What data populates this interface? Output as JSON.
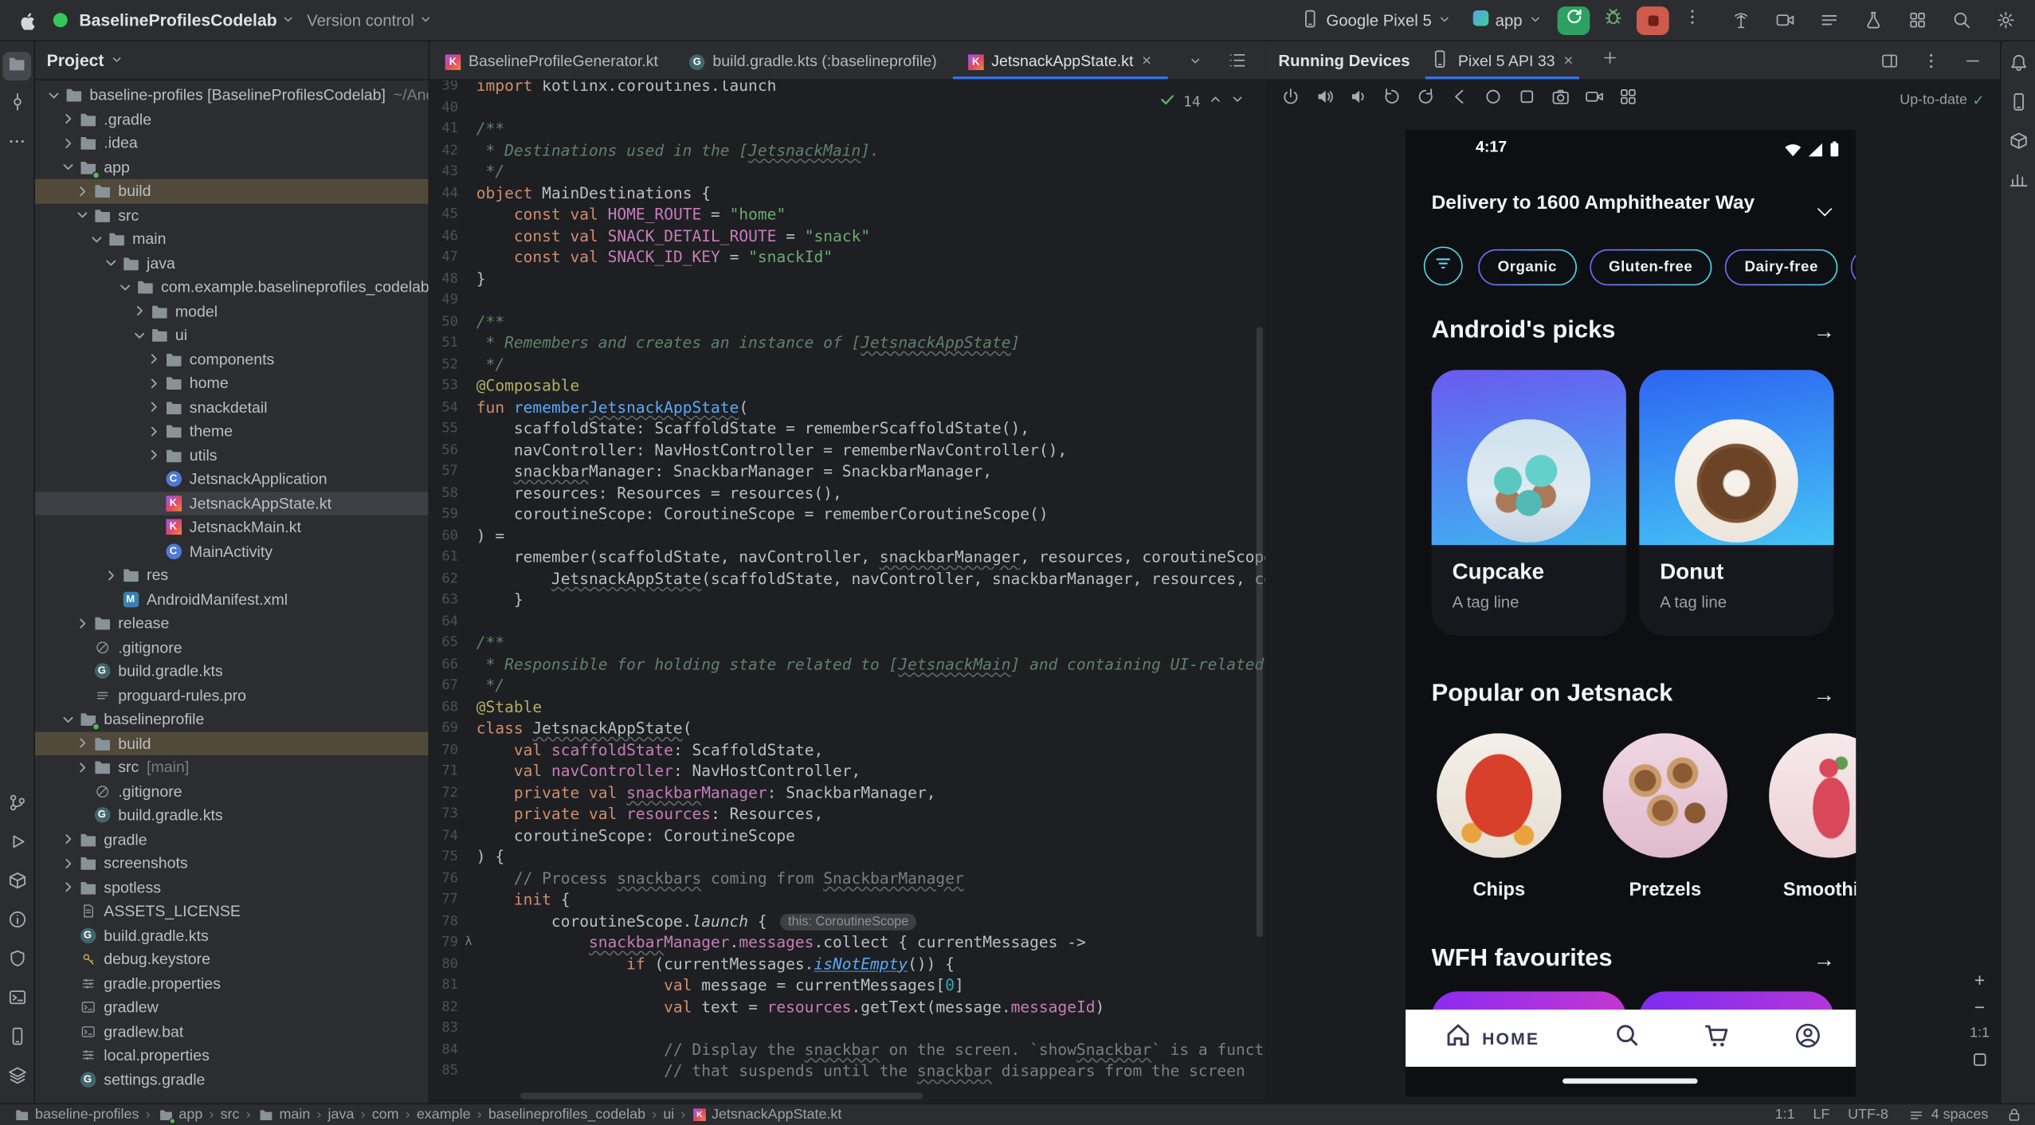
{
  "colors": {
    "accent_blue": "#3574f0",
    "run_green": "#2ea062",
    "stop_red": "#cf5b4c",
    "chip_cyan": "#46d8e6",
    "chip_violet": "#7b61f8",
    "selection_brown": "#514a3b"
  },
  "titlebar": {
    "project_name": "BaselineProfilesCodelab",
    "version_control_label": "Version control",
    "device_selector": "Google Pixel 5",
    "run_config": "app"
  },
  "project_panel": {
    "title": "Project",
    "tree": [
      {
        "lv": 0,
        "ch": "d",
        "ic": "folder",
        "la": "baseline-profiles [BaselineProfilesCodelab]",
        "ex": "~/Andr"
      },
      {
        "lv": 1,
        "ch": "r",
        "ic": "folder",
        "la": ".gradle"
      },
      {
        "lv": 1,
        "ch": "r",
        "ic": "folder",
        "la": ".idea"
      },
      {
        "lv": 1,
        "ch": "d",
        "ic": "module",
        "la": "app"
      },
      {
        "lv": 2,
        "ch": "r",
        "ic": "folder",
        "la": "build",
        "hl": 1
      },
      {
        "lv": 2,
        "ch": "d",
        "ic": "folder",
        "la": "src"
      },
      {
        "lv": 3,
        "ch": "d",
        "ic": "folder",
        "la": "main"
      },
      {
        "lv": 4,
        "ch": "d",
        "ic": "folder",
        "la": "java"
      },
      {
        "lv": 5,
        "ch": "d",
        "ic": "package",
        "la": "com.example.baselineprofiles_codelab"
      },
      {
        "lv": 6,
        "ch": "r",
        "ic": "folder",
        "la": "model"
      },
      {
        "lv": 6,
        "ch": "d",
        "ic": "folder",
        "la": "ui"
      },
      {
        "lv": 7,
        "ch": "r",
        "ic": "folder",
        "la": "components"
      },
      {
        "lv": 7,
        "ch": "r",
        "ic": "folder",
        "la": "home"
      },
      {
        "lv": 7,
        "ch": "r",
        "ic": "folder",
        "la": "snackdetail"
      },
      {
        "lv": 7,
        "ch": "r",
        "ic": "folder",
        "la": "theme"
      },
      {
        "lv": 7,
        "ch": "r",
        "ic": "folder",
        "la": "utils"
      },
      {
        "lv": 7,
        "ch": "",
        "ic": "class",
        "la": "JetsnackApplication"
      },
      {
        "lv": 7,
        "ch": "",
        "ic": "kotlin",
        "la": "JetsnackAppState.kt",
        "sel": 1
      },
      {
        "lv": 7,
        "ch": "",
        "ic": "kotlin",
        "la": "JetsnackMain.kt"
      },
      {
        "lv": 7,
        "ch": "",
        "ic": "class",
        "la": "MainActivity"
      },
      {
        "lv": 4,
        "ch": "r",
        "ic": "folder",
        "la": "res"
      },
      {
        "lv": 4,
        "ch": "",
        "ic": "manifest",
        "la": "AndroidManifest.xml"
      },
      {
        "lv": 2,
        "ch": "r",
        "ic": "folder",
        "la": "release"
      },
      {
        "lv": 2,
        "ch": "",
        "ic": "ignore",
        "la": ".gitignore"
      },
      {
        "lv": 2,
        "ch": "",
        "ic": "gradle",
        "la": "build.gradle.kts"
      },
      {
        "lv": 2,
        "ch": "",
        "ic": "pro",
        "la": "proguard-rules.pro"
      },
      {
        "lv": 1,
        "ch": "d",
        "ic": "module",
        "la": "baselineprofile"
      },
      {
        "lv": 2,
        "ch": "r",
        "ic": "folder",
        "la": "build",
        "hl": 1
      },
      {
        "lv": 2,
        "ch": "r",
        "ic": "folder",
        "la": "src",
        "ex": "[main]"
      },
      {
        "lv": 2,
        "ch": "",
        "ic": "ignore",
        "la": ".gitignore"
      },
      {
        "lv": 2,
        "ch": "",
        "ic": "gradle",
        "la": "build.gradle.kts"
      },
      {
        "lv": 1,
        "ch": "r",
        "ic": "folder",
        "la": "gradle"
      },
      {
        "lv": 1,
        "ch": "r",
        "ic": "folder",
        "la": "screenshots"
      },
      {
        "lv": 1,
        "ch": "r",
        "ic": "folder",
        "la": "spotless"
      },
      {
        "lv": 1,
        "ch": "",
        "ic": "text",
        "la": "ASSETS_LICENSE"
      },
      {
        "lv": 1,
        "ch": "",
        "ic": "gradle",
        "la": "build.gradle.kts"
      },
      {
        "lv": 1,
        "ch": "",
        "ic": "key",
        "la": "debug.keystore"
      },
      {
        "lv": 1,
        "ch": "",
        "ic": "props",
        "la": "gradle.properties"
      },
      {
        "lv": 1,
        "ch": "",
        "ic": "shell",
        "la": "gradlew"
      },
      {
        "lv": 1,
        "ch": "",
        "ic": "shell",
        "la": "gradlew.bat"
      },
      {
        "lv": 1,
        "ch": "",
        "ic": "props",
        "la": "local.properties"
      },
      {
        "lv": 1,
        "ch": "",
        "ic": "gradle",
        "la": "settings.gradle"
      }
    ]
  },
  "editor": {
    "tabs": [
      {
        "label": "BaselineProfileGenerator.kt",
        "icon": "kotlin"
      },
      {
        "label": "build.gradle.kts (:baselineprofile)",
        "icon": "gradle"
      },
      {
        "label": "JetsnackAppState.kt",
        "icon": "kotlin",
        "active": 1
      }
    ],
    "inspections_count": "14",
    "lines": [
      {
        "n": 39,
        "s": [
          [
            "k",
            "import"
          ],
          [
            "t",
            " kotlinx.coroutines.launch"
          ]
        ]
      },
      {
        "n": 40,
        "s": []
      },
      {
        "n": 41,
        "s": [
          [
            "d",
            "/**"
          ]
        ]
      },
      {
        "n": 42,
        "s": [
          [
            "d",
            " * Destinations used in the ["
          ],
          [
            "d u",
            "JetsnackMain"
          ],
          [
            "d",
            "]."
          ]
        ]
      },
      {
        "n": 43,
        "s": [
          [
            "d",
            " */"
          ]
        ]
      },
      {
        "n": 44,
        "s": [
          [
            "k",
            "object"
          ],
          [
            "t",
            " MainDestinations {"
          ]
        ]
      },
      {
        "n": 45,
        "s": [
          [
            "t",
            "    "
          ],
          [
            "k",
            "const"
          ],
          [
            "t",
            " "
          ],
          [
            "k",
            "val"
          ],
          [
            "t",
            " "
          ],
          [
            "p",
            "HOME_ROUTE"
          ],
          [
            "t",
            " = "
          ],
          [
            "s",
            "\"home\""
          ]
        ]
      },
      {
        "n": 46,
        "s": [
          [
            "t",
            "    "
          ],
          [
            "k",
            "const"
          ],
          [
            "t",
            " "
          ],
          [
            "k",
            "val"
          ],
          [
            "t",
            " "
          ],
          [
            "p",
            "SNACK_DETAIL_ROUTE"
          ],
          [
            "t",
            " = "
          ],
          [
            "s",
            "\"snack\""
          ]
        ]
      },
      {
        "n": 47,
        "s": [
          [
            "t",
            "    "
          ],
          [
            "k",
            "const"
          ],
          [
            "t",
            " "
          ],
          [
            "k",
            "val"
          ],
          [
            "t",
            " "
          ],
          [
            "p",
            "SNACK_ID_KEY"
          ],
          [
            "t",
            " = "
          ],
          [
            "s",
            "\"snackId\""
          ]
        ]
      },
      {
        "n": 48,
        "s": [
          [
            "t",
            "}"
          ]
        ]
      },
      {
        "n": 49,
        "s": []
      },
      {
        "n": 50,
        "s": [
          [
            "d",
            "/**"
          ]
        ]
      },
      {
        "n": 51,
        "s": [
          [
            "d",
            " * Remembers and creates an instance of ["
          ],
          [
            "d u",
            "JetsnackAppState"
          ],
          [
            "d",
            "]"
          ]
        ]
      },
      {
        "n": 52,
        "s": [
          [
            "d",
            " */"
          ]
        ]
      },
      {
        "n": 53,
        "s": [
          [
            "a",
            "@Composable"
          ]
        ]
      },
      {
        "n": 54,
        "s": [
          [
            "k",
            "fun"
          ],
          [
            "t",
            " "
          ],
          [
            "fn",
            "remember"
          ],
          [
            "fn u",
            "JetsnackAppState"
          ],
          [
            "t",
            "("
          ]
        ]
      },
      {
        "n": 55,
        "s": [
          [
            "t",
            "    scaffoldState: ScaffoldState = rememberScaffoldState(),"
          ]
        ]
      },
      {
        "n": 56,
        "s": [
          [
            "t",
            "    navController: NavHostController = rememberNavController(),"
          ]
        ]
      },
      {
        "n": 57,
        "s": [
          [
            "t",
            "    "
          ],
          [
            "t u",
            "snackbar"
          ],
          [
            "t",
            "Manager: SnackbarManager = SnackbarManager,"
          ]
        ]
      },
      {
        "n": 58,
        "s": [
          [
            "t",
            "    resources: Resources = resources(),"
          ]
        ]
      },
      {
        "n": 59,
        "s": [
          [
            "t",
            "    coroutineScope: CoroutineScope = rememberCoroutineScope()"
          ]
        ]
      },
      {
        "n": 60,
        "s": [
          [
            "t",
            ") ="
          ]
        ]
      },
      {
        "n": 61,
        "s": [
          [
            "t",
            "    remember(scaffoldState, navController, "
          ],
          [
            "t u",
            "snackbarManager"
          ],
          [
            "t",
            ", resources, coroutineScope) {"
          ]
        ]
      },
      {
        "n": 62,
        "s": [
          [
            "t",
            "        "
          ],
          [
            "t u",
            "JetsnackAppState"
          ],
          [
            "t",
            "(scaffoldState, navController, snackbarManager, resources, coroutineScope)"
          ]
        ]
      },
      {
        "n": 63,
        "s": [
          [
            "t",
            "    }"
          ]
        ]
      },
      {
        "n": 64,
        "s": []
      },
      {
        "n": 65,
        "s": [
          [
            "d",
            "/**"
          ]
        ]
      },
      {
        "n": 66,
        "s": [
          [
            "d",
            " * Responsible for holding state related to ["
          ],
          [
            "d u",
            "JetsnackMain"
          ],
          [
            "d",
            "] and containing UI-related logic."
          ]
        ]
      },
      {
        "n": 67,
        "s": [
          [
            "d",
            " */"
          ]
        ]
      },
      {
        "n": 68,
        "s": [
          [
            "a",
            "@Stable"
          ]
        ]
      },
      {
        "n": 69,
        "s": [
          [
            "k",
            "class"
          ],
          [
            "t",
            " "
          ],
          [
            "t u",
            "JetsnackAppState"
          ],
          [
            "t",
            "("
          ]
        ]
      },
      {
        "n": 70,
        "s": [
          [
            "t",
            "    "
          ],
          [
            "k",
            "val"
          ],
          [
            "t",
            " "
          ],
          [
            "p",
            "scaffoldState"
          ],
          [
            "t",
            ": ScaffoldState,"
          ]
        ]
      },
      {
        "n": 71,
        "s": [
          [
            "t",
            "    "
          ],
          [
            "k",
            "val"
          ],
          [
            "t",
            " "
          ],
          [
            "p",
            "navController"
          ],
          [
            "t",
            ": NavHostController,"
          ]
        ]
      },
      {
        "n": 72,
        "s": [
          [
            "t",
            "    "
          ],
          [
            "k",
            "private"
          ],
          [
            "t",
            " "
          ],
          [
            "k",
            "val"
          ],
          [
            "t",
            " "
          ],
          [
            "p u",
            "snackbar"
          ],
          [
            "p",
            "Manager"
          ],
          [
            "t",
            ": SnackbarManager,"
          ]
        ]
      },
      {
        "n": 73,
        "s": [
          [
            "t",
            "    "
          ],
          [
            "k",
            "private"
          ],
          [
            "t",
            " "
          ],
          [
            "k",
            "val"
          ],
          [
            "t",
            " "
          ],
          [
            "p",
            "resources"
          ],
          [
            "t",
            ": Resources,"
          ]
        ]
      },
      {
        "n": 74,
        "s": [
          [
            "t",
            "    coroutineScope: CoroutineScope"
          ]
        ]
      },
      {
        "n": 75,
        "s": [
          [
            "t",
            ") {"
          ]
        ]
      },
      {
        "n": 76,
        "s": [
          [
            "c",
            "    // Process "
          ],
          [
            "c u",
            "snackbars"
          ],
          [
            "c",
            " coming from "
          ],
          [
            "c u",
            "SnackbarManager"
          ]
        ]
      },
      {
        "n": 77,
        "s": [
          [
            "t",
            "    "
          ],
          [
            "k",
            "init"
          ],
          [
            "t",
            " {"
          ]
        ]
      },
      {
        "n": 78,
        "s": [
          [
            "t",
            "        coroutineScope."
          ],
          [
            "it",
            "launch"
          ],
          [
            "t",
            " { "
          ],
          [
            "chip",
            "this: CoroutineScope"
          ]
        ]
      },
      {
        "n": 79,
        "g": 1,
        "s": [
          [
            "t",
            "            "
          ],
          [
            "p u",
            "snackbar"
          ],
          [
            "p",
            "Manager"
          ],
          [
            "t",
            "."
          ],
          [
            "p",
            "messages"
          ],
          [
            "t",
            ".collect { currentMessages ->"
          ]
        ]
      },
      {
        "n": 80,
        "s": [
          [
            "t",
            "                "
          ],
          [
            "k",
            "if"
          ],
          [
            "t",
            " (currentMessages."
          ],
          [
            "fni",
            "isNotEmpty"
          ],
          [
            "t",
            "()) {"
          ]
        ]
      },
      {
        "n": 81,
        "s": [
          [
            "t",
            "                    "
          ],
          [
            "k",
            "val"
          ],
          [
            "t",
            " message = currentMessages["
          ],
          [
            "n",
            "0"
          ],
          [
            "t",
            "]"
          ]
        ]
      },
      {
        "n": 82,
        "s": [
          [
            "t",
            "                    "
          ],
          [
            "k",
            "val"
          ],
          [
            "t",
            " text = "
          ],
          [
            "p",
            "resources"
          ],
          [
            "t",
            ".getText(message."
          ],
          [
            "p",
            "messageId"
          ],
          [
            "t",
            ")"
          ]
        ]
      },
      {
        "n": 83,
        "s": []
      },
      {
        "n": 84,
        "s": [
          [
            "c",
            "                    // Display the "
          ],
          [
            "c u",
            "snackbar"
          ],
          [
            "c",
            " on the screen. `show"
          ],
          [
            "c u",
            "Snackbar"
          ],
          [
            "c",
            "` is a function"
          ]
        ]
      },
      {
        "n": 85,
        "s": [
          [
            "c",
            "                    // that suspends until the "
          ],
          [
            "c u",
            "snackbar"
          ],
          [
            "c",
            " disappears from the screen"
          ]
        ]
      }
    ]
  },
  "devices_panel": {
    "title": "Running Devices",
    "device_tab": "Pixel 5 API 33",
    "up_to_date": "Up-to-date",
    "zoom_ratio": "1:1",
    "phone": {
      "time": "4:17",
      "delivery": "Delivery to 1600 Amphitheater Way",
      "filters": [
        "Organic",
        "Gluten-free",
        "Dairy-free",
        ""
      ],
      "sections": [
        {
          "title": "Android's picks"
        },
        {
          "title": "Popular on Jetsnack"
        },
        {
          "title": "WFH favourites"
        }
      ],
      "picks": [
        {
          "name": "Cupcake",
          "tag": "A tag line",
          "img": "cupcake"
        },
        {
          "name": "Donut",
          "tag": "A tag line",
          "img": "donut"
        }
      ],
      "popular": [
        {
          "name": "Chips",
          "img": "chips"
        },
        {
          "name": "Pretzels",
          "img": "pretzels"
        },
        {
          "name": "Smoothies",
          "img": "smoothie"
        }
      ],
      "nav_home_label": "HOME"
    }
  },
  "statusbar": {
    "breadcrumbs": [
      {
        "t": "baseline-profiles",
        "ic": "folder"
      },
      {
        "t": "app",
        "ic": "module"
      },
      {
        "t": "src"
      },
      {
        "t": "main",
        "ic": "folder"
      },
      {
        "t": "java"
      },
      {
        "t": "com"
      },
      {
        "t": "example"
      },
      {
        "t": "baselineprofiles_codelab"
      },
      {
        "t": "ui"
      },
      {
        "t": "JetsnackAppState.kt",
        "ic": "kotlin"
      }
    ],
    "caret": "1:1",
    "line_sep": "LF",
    "encoding": "UTF-8",
    "indent": "4 spaces"
  }
}
